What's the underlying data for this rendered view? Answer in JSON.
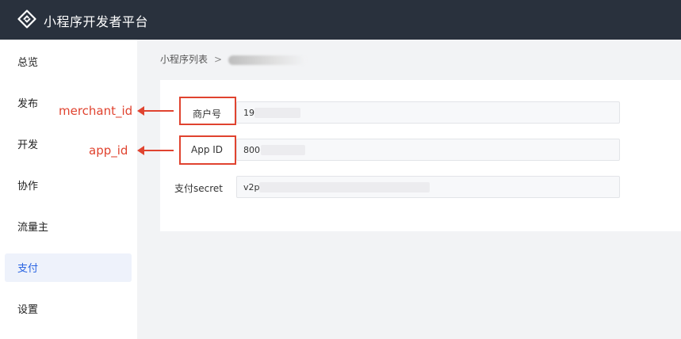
{
  "header": {
    "title": "小程序开发者平台",
    "logo_icon": "link-logo-icon"
  },
  "sidebar": {
    "items": [
      {
        "label": "总览",
        "active": false
      },
      {
        "label": "发布",
        "active": false
      },
      {
        "label": "开发",
        "active": false
      },
      {
        "label": "协作",
        "active": false
      },
      {
        "label": "流量主",
        "active": false
      },
      {
        "label": "支付",
        "active": true
      },
      {
        "label": "设置",
        "active": false
      }
    ]
  },
  "breadcrumb": {
    "root": "小程序列表",
    "separator": ">"
  },
  "form": {
    "merchant_label": "商户号",
    "merchant_value": "19(",
    "appid_label": "App ID",
    "appid_value": "800(",
    "secret_label": "支付secret",
    "secret_value": "v2p"
  },
  "annotations": {
    "merchant": "merchant_id",
    "app": "app_id"
  },
  "colors": {
    "topbar": "#29313d",
    "accent": "#2a64e2",
    "annotation": "#e0432f"
  }
}
